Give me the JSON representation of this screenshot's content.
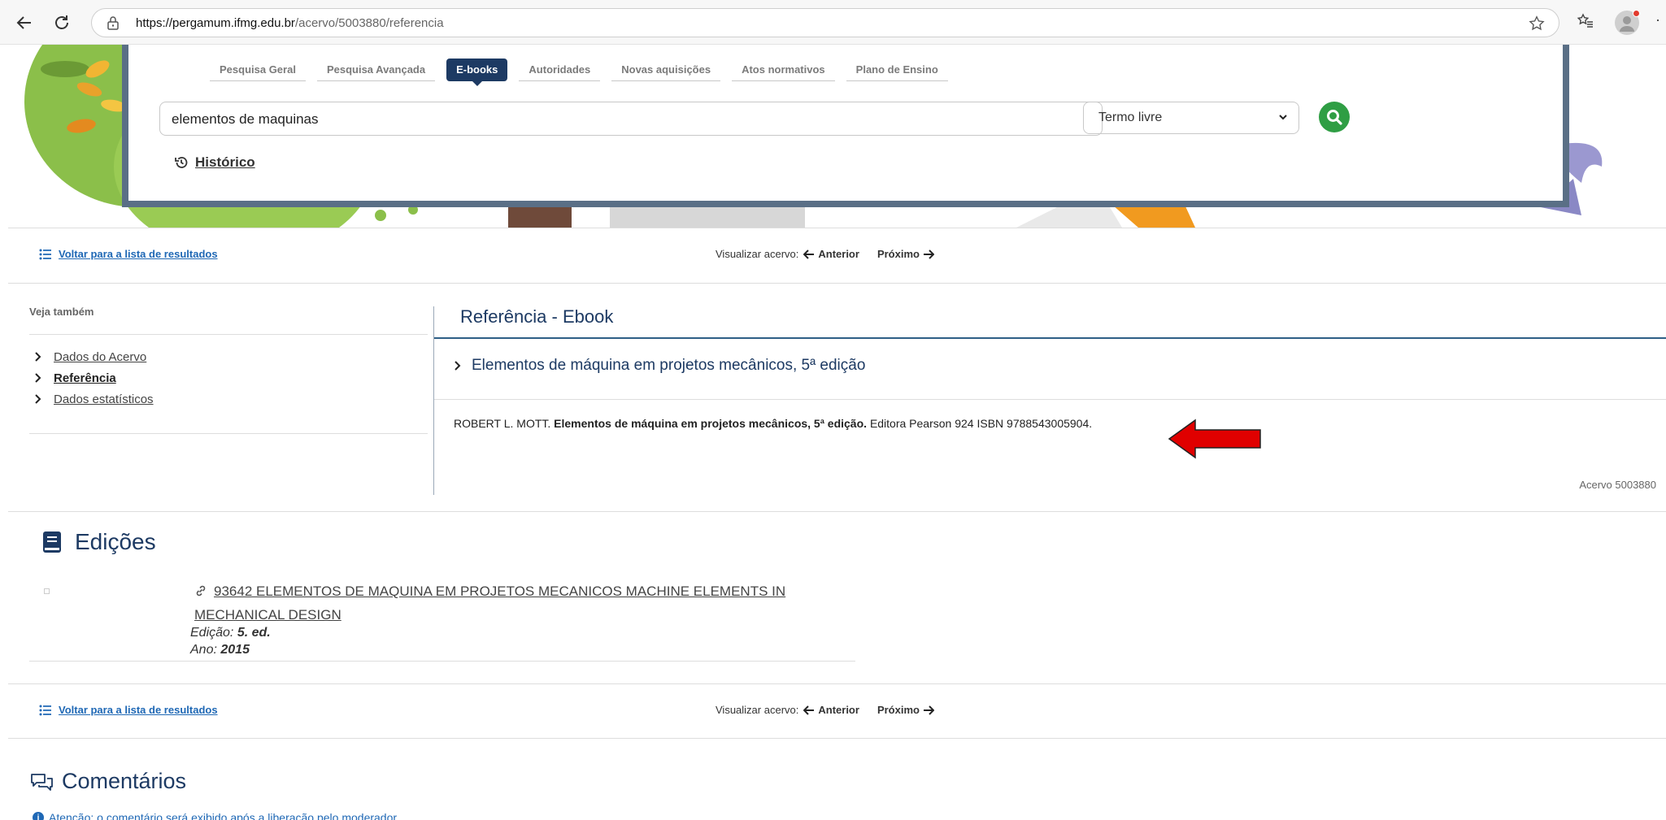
{
  "browser": {
    "url_host": "https://pergamum.ifmg.edu.br",
    "url_path": "/acervo/5003880/referencia",
    "more_label": "·"
  },
  "search": {
    "tabs": [
      {
        "label": "Pesquisa Geral"
      },
      {
        "label": "Pesquisa Avançada"
      },
      {
        "label": "E-books"
      },
      {
        "label": "Autoridades"
      },
      {
        "label": "Novas aquisições"
      },
      {
        "label": "Atos normativos"
      },
      {
        "label": "Plano de Ensino"
      }
    ],
    "active_tab": "E-books",
    "query": "elementos de maquinas",
    "field_select": "Termo livre",
    "history_label": "Histórico"
  },
  "nav": {
    "back_label": "Voltar para a lista de resultados",
    "view_label": "Visualizar acervo:",
    "prev_label": "Anterior",
    "next_label": "Próximo"
  },
  "sidebar": {
    "heading": "Veja também",
    "items": [
      {
        "label": "Dados do Acervo"
      },
      {
        "label": "Referência"
      },
      {
        "label": "Dados estatísticos"
      }
    ],
    "active_item": "Referência"
  },
  "reference": {
    "title": "Referência - Ebook",
    "book_title": "Elementos de máquina em projetos mecânicos, 5ª edição",
    "citation_author": "ROBERT L. MOTT.",
    "citation_title": "Elementos de máquina em projetos mecânicos, 5ª edição.",
    "citation_rest": "Editora Pearson 924 ISBN 9788543005904.",
    "acervo": "Acervo 5003880"
  },
  "editions": {
    "title": "Edições",
    "item": {
      "link_line1": "93642 ELEMENTOS DE MAQUINA EM PROJETOS MECANICOS MACHINE ELEMENTS IN",
      "link_line2": "MECHANICAL DESIGN",
      "edition_label": "Edição:",
      "edition_value": "5. ed.",
      "year_label": "Ano:",
      "year_value": "2015"
    }
  },
  "comments": {
    "title": "Comentários",
    "notice": "Atenção: o comentário será exibido após a liberação pelo moderador"
  },
  "colors": {
    "primary": "#1d3a63",
    "link": "#1f68b5",
    "search_button": "#2f9e44",
    "arrow": "#e00000",
    "banner_frame": "#5a6f86"
  },
  "icons": [
    "back-arrow-icon",
    "reload-icon",
    "lock-icon",
    "star-icon",
    "favorites-icon",
    "history-icon",
    "search-icon",
    "list-icon",
    "chevron-right-icon",
    "book-icon",
    "link-icon",
    "comments-icon",
    "info-icon",
    "red-arrow-icon"
  ]
}
